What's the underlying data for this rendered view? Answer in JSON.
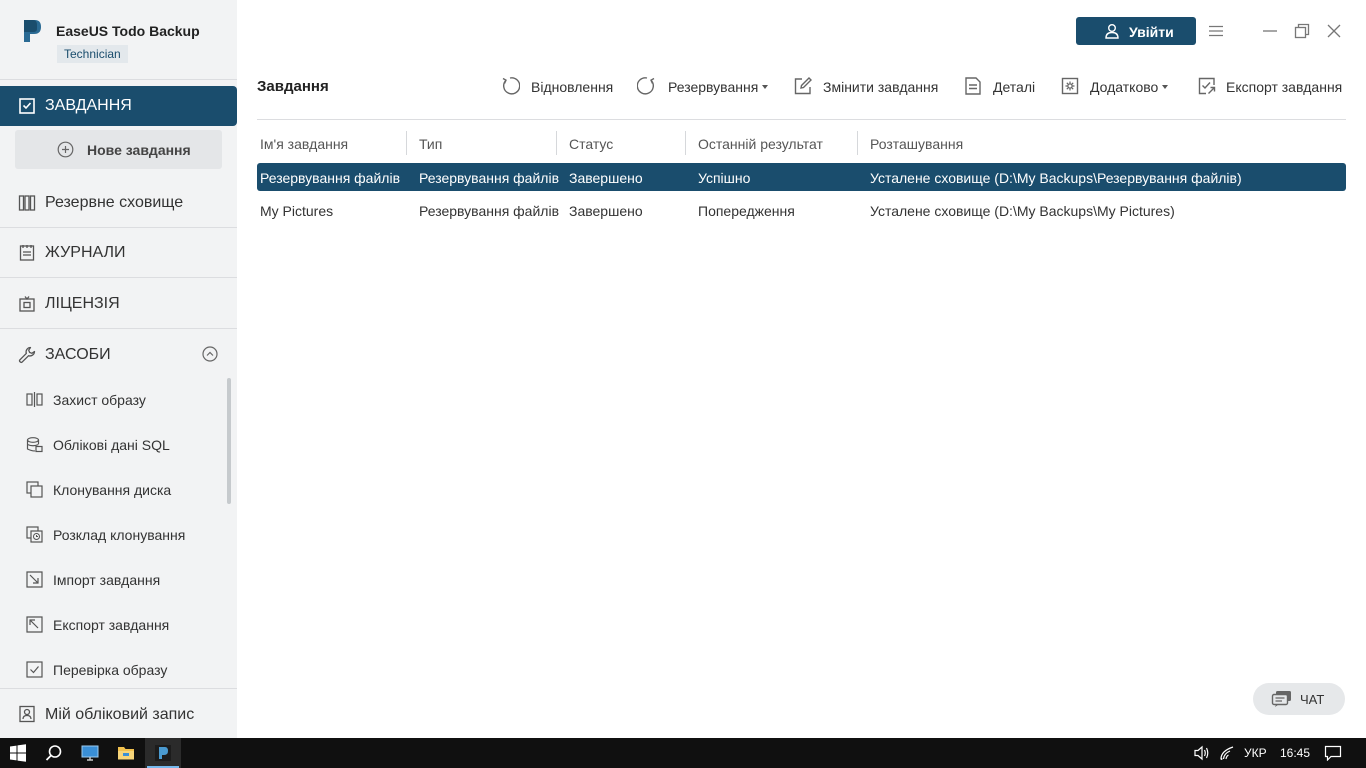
{
  "app": {
    "title": "EaseUS Todo Backup",
    "edition": "Technician"
  },
  "sidebar": {
    "tasks_label": "ЗАВДАННЯ",
    "new_task_label": "Нове завдання",
    "backup_storage_label": "Резервне сховище",
    "logs_label": "ЖУРНАЛИ",
    "license_label": "ЛІЦЕНЗІЯ",
    "tools_label": "ЗАСОБИ",
    "tools": [
      {
        "label": "Захист образу",
        "icon": "image-protect-icon"
      },
      {
        "label": "Облікові дані SQL",
        "icon": "sql-credentials-icon"
      },
      {
        "label": "Клонування диска",
        "icon": "disk-clone-icon"
      },
      {
        "label": "Розклад клонування",
        "icon": "clone-schedule-icon"
      },
      {
        "label": "Імпорт завдання",
        "icon": "import-task-icon"
      },
      {
        "label": "Експорт завдання",
        "icon": "export-task-icon"
      },
      {
        "label": "Перевірка образу",
        "icon": "check-image-icon"
      }
    ],
    "account_label": "Мій обліковий запис"
  },
  "header": {
    "login_label": "Увійти"
  },
  "toolbar": {
    "page_title": "Завдання",
    "restore_label": "Відновлення",
    "backup_label": "Резервування",
    "edit_label": "Змінити завдання",
    "details_label": "Деталі",
    "advanced_label": "Додатково",
    "export_label": "Експорт завдання"
  },
  "table": {
    "columns": [
      "Ім'я завдання",
      "Тип",
      "Статус",
      "Останній результат",
      "Розташування"
    ],
    "rows": [
      [
        "Резервування файлів",
        "Резервування файлів",
        "Завершено",
        "Успішно",
        "Усталене сховище (D:\\My Backups\\Резервування файлів)"
      ],
      [
        "My Pictures",
        "Резервування файлів",
        "Завершено",
        "Попередження",
        "Усталене сховище (D:\\My Backups\\My Pictures)"
      ]
    ]
  },
  "chat": {
    "label": "ЧАТ"
  },
  "taskbar": {
    "language": "УКР",
    "time": "16:45"
  },
  "colors": {
    "accent": "#1a4d6d",
    "sidebar_bg": "#f2f3f4",
    "taskbar_bg": "#101010"
  }
}
